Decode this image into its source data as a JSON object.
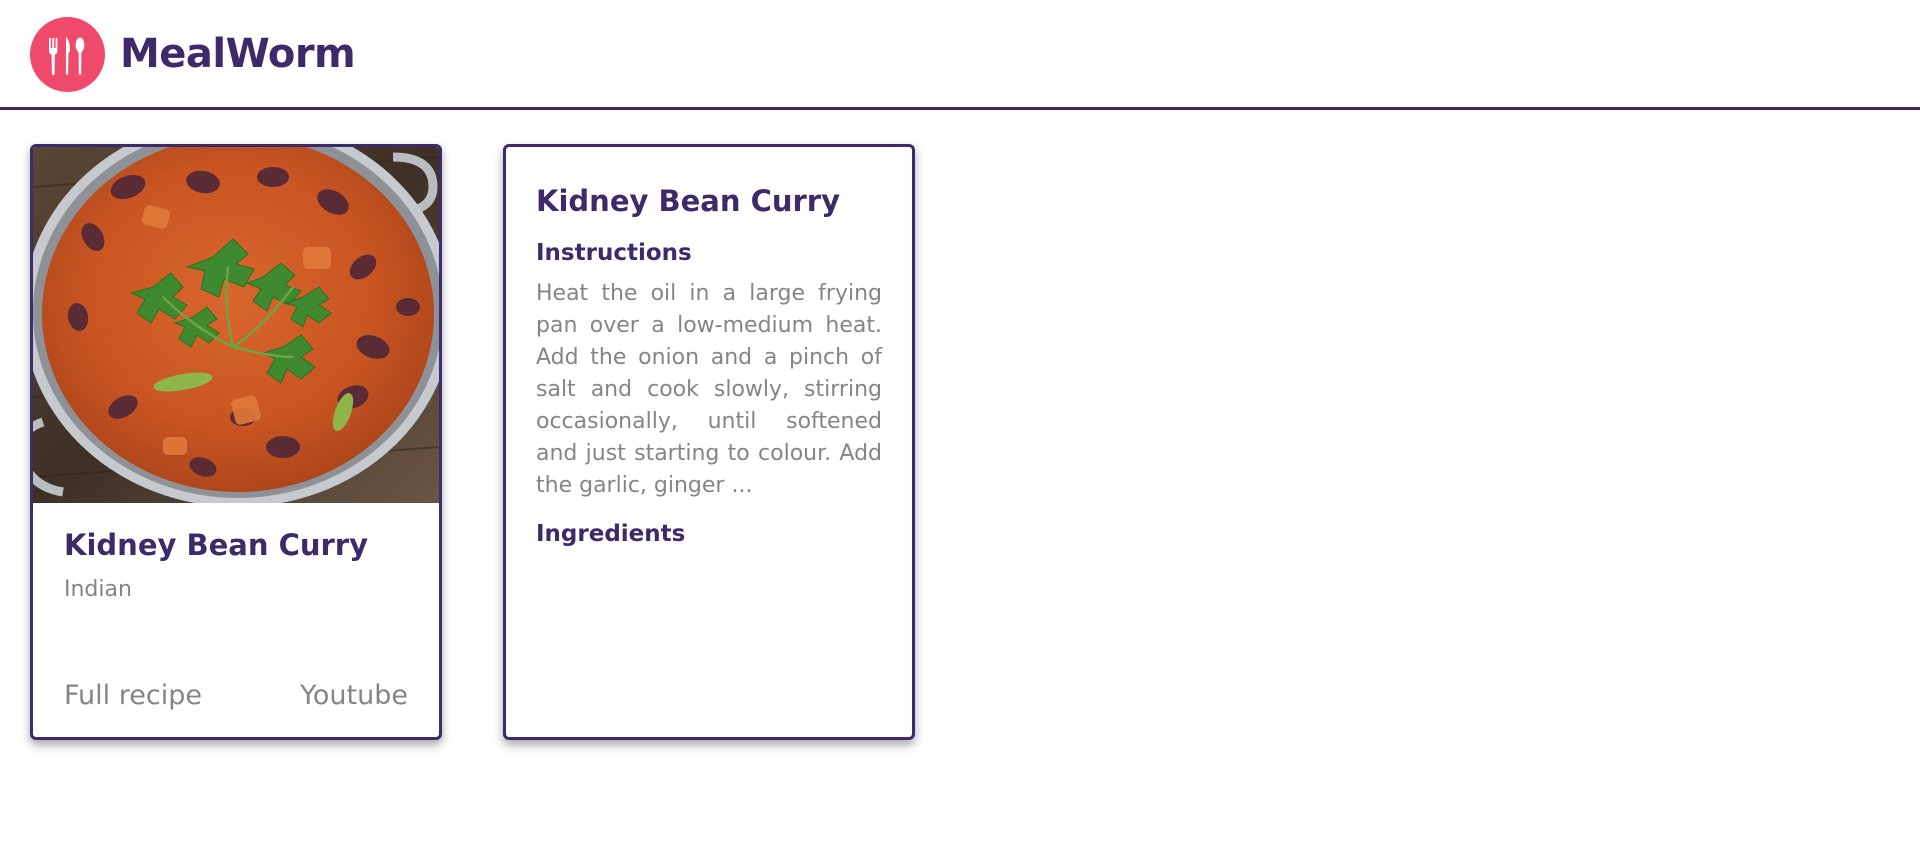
{
  "app": {
    "name": "MealWorm",
    "logo_icon": "utensils-icon"
  },
  "colors": {
    "brand": "#3d2a6b",
    "logo_bg": "#ef4a6c",
    "muted_text": "#858585"
  },
  "recipe_card": {
    "title": "Kidney Bean Curry",
    "cuisine": "Indian",
    "image": "kidney-bean-curry-photo",
    "full_recipe_label": "Full recipe",
    "youtube_label": "Youtube"
  },
  "detail_card": {
    "title": "Kidney Bean Curry",
    "instructions_heading": "Instructions",
    "instructions_text": "Heat the oil in a large frying pan over a low-medium heat. Add the onion and a pinch of salt and cook slowly, stirring occasionally, until softened and just starting to colour. Add the garlic, ginger ...",
    "ingredients_heading": "Ingredients"
  }
}
